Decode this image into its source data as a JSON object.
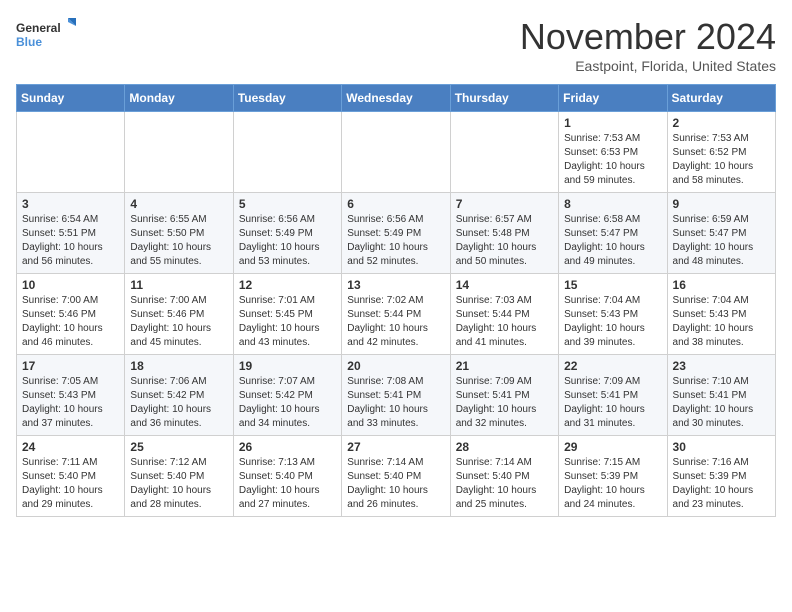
{
  "header": {
    "logo_general": "General",
    "logo_blue": "Blue",
    "month_year": "November 2024",
    "location": "Eastpoint, Florida, United States"
  },
  "days_of_week": [
    "Sunday",
    "Monday",
    "Tuesday",
    "Wednesday",
    "Thursday",
    "Friday",
    "Saturday"
  ],
  "weeks": [
    [
      {
        "day": "",
        "info": ""
      },
      {
        "day": "",
        "info": ""
      },
      {
        "day": "",
        "info": ""
      },
      {
        "day": "",
        "info": ""
      },
      {
        "day": "",
        "info": ""
      },
      {
        "day": "1",
        "info": "Sunrise: 7:53 AM\nSunset: 6:53 PM\nDaylight: 10 hours and 59 minutes."
      },
      {
        "day": "2",
        "info": "Sunrise: 7:53 AM\nSunset: 6:52 PM\nDaylight: 10 hours and 58 minutes."
      }
    ],
    [
      {
        "day": "3",
        "info": "Sunrise: 6:54 AM\nSunset: 5:51 PM\nDaylight: 10 hours and 56 minutes."
      },
      {
        "day": "4",
        "info": "Sunrise: 6:55 AM\nSunset: 5:50 PM\nDaylight: 10 hours and 55 minutes."
      },
      {
        "day": "5",
        "info": "Sunrise: 6:56 AM\nSunset: 5:49 PM\nDaylight: 10 hours and 53 minutes."
      },
      {
        "day": "6",
        "info": "Sunrise: 6:56 AM\nSunset: 5:49 PM\nDaylight: 10 hours and 52 minutes."
      },
      {
        "day": "7",
        "info": "Sunrise: 6:57 AM\nSunset: 5:48 PM\nDaylight: 10 hours and 50 minutes."
      },
      {
        "day": "8",
        "info": "Sunrise: 6:58 AM\nSunset: 5:47 PM\nDaylight: 10 hours and 49 minutes."
      },
      {
        "day": "9",
        "info": "Sunrise: 6:59 AM\nSunset: 5:47 PM\nDaylight: 10 hours and 48 minutes."
      }
    ],
    [
      {
        "day": "10",
        "info": "Sunrise: 7:00 AM\nSunset: 5:46 PM\nDaylight: 10 hours and 46 minutes."
      },
      {
        "day": "11",
        "info": "Sunrise: 7:00 AM\nSunset: 5:46 PM\nDaylight: 10 hours and 45 minutes."
      },
      {
        "day": "12",
        "info": "Sunrise: 7:01 AM\nSunset: 5:45 PM\nDaylight: 10 hours and 43 minutes."
      },
      {
        "day": "13",
        "info": "Sunrise: 7:02 AM\nSunset: 5:44 PM\nDaylight: 10 hours and 42 minutes."
      },
      {
        "day": "14",
        "info": "Sunrise: 7:03 AM\nSunset: 5:44 PM\nDaylight: 10 hours and 41 minutes."
      },
      {
        "day": "15",
        "info": "Sunrise: 7:04 AM\nSunset: 5:43 PM\nDaylight: 10 hours and 39 minutes."
      },
      {
        "day": "16",
        "info": "Sunrise: 7:04 AM\nSunset: 5:43 PM\nDaylight: 10 hours and 38 minutes."
      }
    ],
    [
      {
        "day": "17",
        "info": "Sunrise: 7:05 AM\nSunset: 5:43 PM\nDaylight: 10 hours and 37 minutes."
      },
      {
        "day": "18",
        "info": "Sunrise: 7:06 AM\nSunset: 5:42 PM\nDaylight: 10 hours and 36 minutes."
      },
      {
        "day": "19",
        "info": "Sunrise: 7:07 AM\nSunset: 5:42 PM\nDaylight: 10 hours and 34 minutes."
      },
      {
        "day": "20",
        "info": "Sunrise: 7:08 AM\nSunset: 5:41 PM\nDaylight: 10 hours and 33 minutes."
      },
      {
        "day": "21",
        "info": "Sunrise: 7:09 AM\nSunset: 5:41 PM\nDaylight: 10 hours and 32 minutes."
      },
      {
        "day": "22",
        "info": "Sunrise: 7:09 AM\nSunset: 5:41 PM\nDaylight: 10 hours and 31 minutes."
      },
      {
        "day": "23",
        "info": "Sunrise: 7:10 AM\nSunset: 5:41 PM\nDaylight: 10 hours and 30 minutes."
      }
    ],
    [
      {
        "day": "24",
        "info": "Sunrise: 7:11 AM\nSunset: 5:40 PM\nDaylight: 10 hours and 29 minutes."
      },
      {
        "day": "25",
        "info": "Sunrise: 7:12 AM\nSunset: 5:40 PM\nDaylight: 10 hours and 28 minutes."
      },
      {
        "day": "26",
        "info": "Sunrise: 7:13 AM\nSunset: 5:40 PM\nDaylight: 10 hours and 27 minutes."
      },
      {
        "day": "27",
        "info": "Sunrise: 7:14 AM\nSunset: 5:40 PM\nDaylight: 10 hours and 26 minutes."
      },
      {
        "day": "28",
        "info": "Sunrise: 7:14 AM\nSunset: 5:40 PM\nDaylight: 10 hours and 25 minutes."
      },
      {
        "day": "29",
        "info": "Sunrise: 7:15 AM\nSunset: 5:39 PM\nDaylight: 10 hours and 24 minutes."
      },
      {
        "day": "30",
        "info": "Sunrise: 7:16 AM\nSunset: 5:39 PM\nDaylight: 10 hours and 23 minutes."
      }
    ]
  ]
}
